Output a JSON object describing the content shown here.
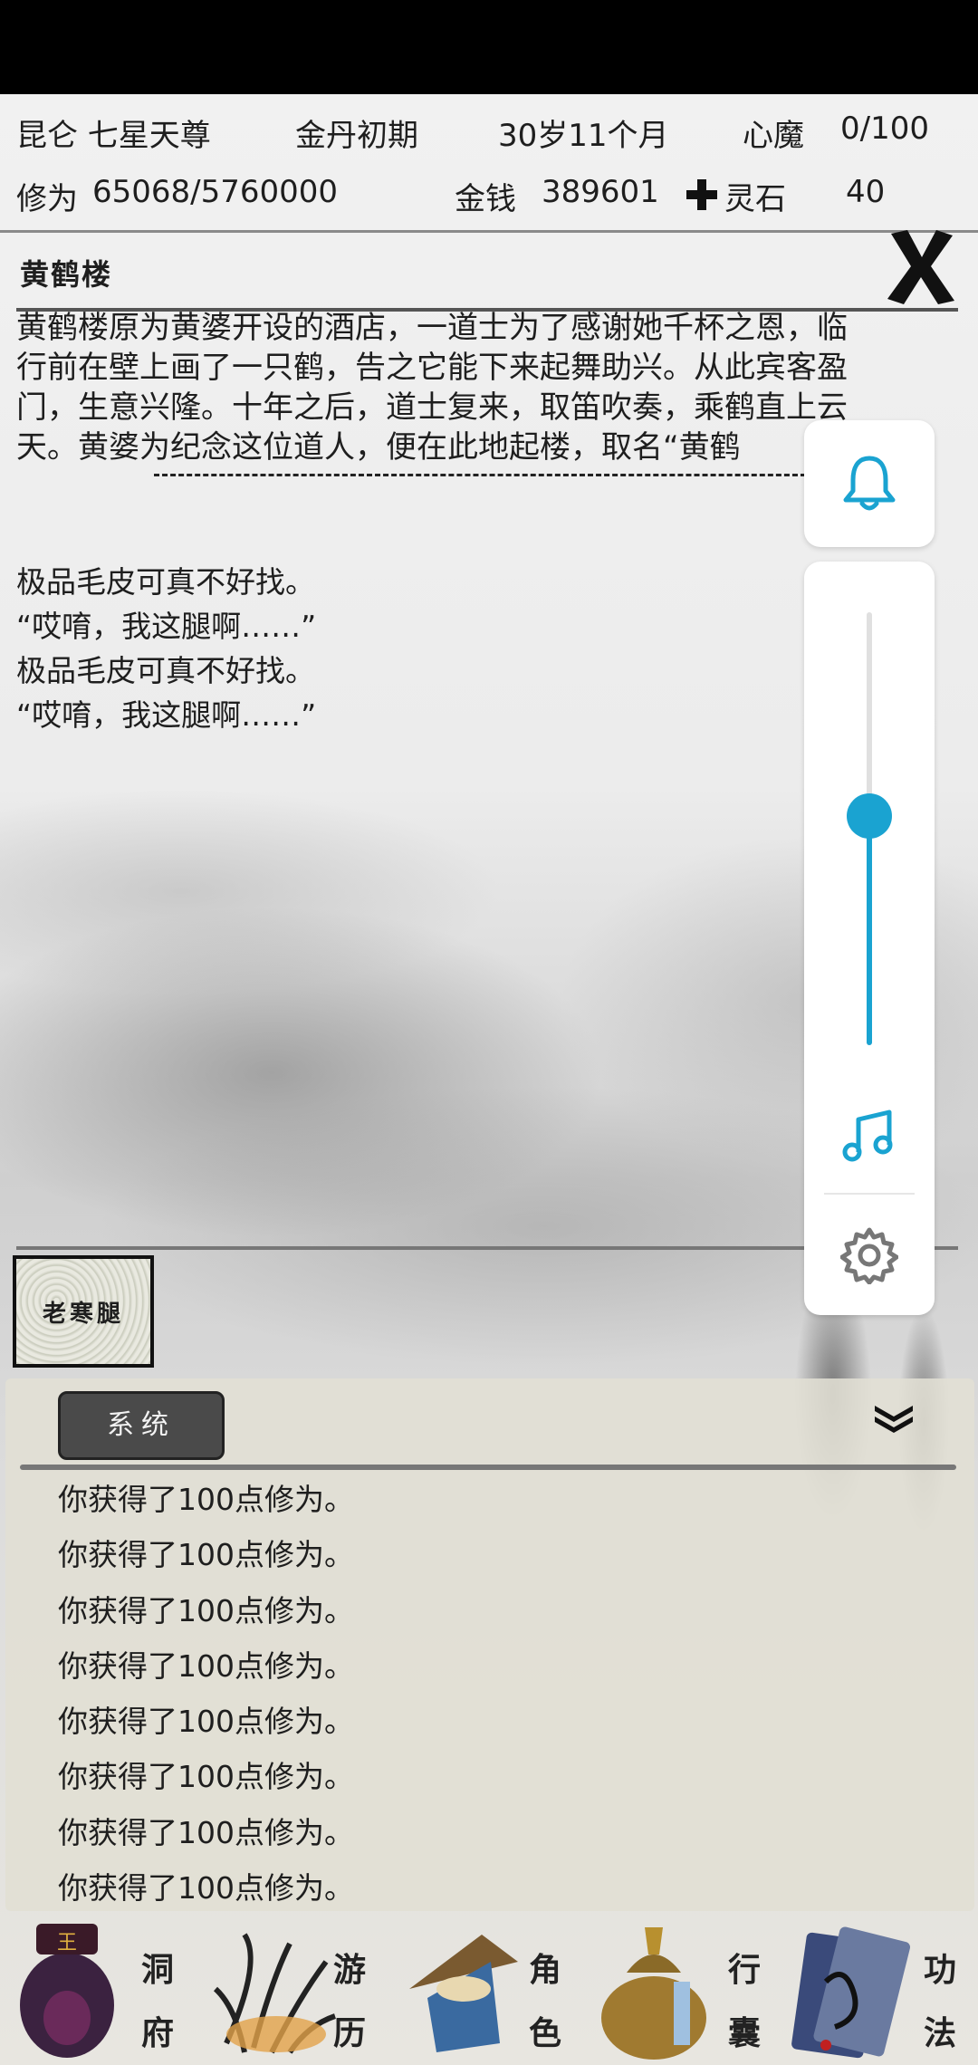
{
  "stats": {
    "sect_title": "昆仑 七星天尊",
    "realm": "金丹初期",
    "age": "30岁11个月",
    "demon_label": "心魔",
    "demon_value": "0/100",
    "cultivation_label": "修为",
    "cultivation_value": "65068/5760000",
    "money_label": "金钱",
    "money_value": "389601",
    "spirit_stone_label": "灵石",
    "spirit_stone_value": "40"
  },
  "location": {
    "title": "黄鹤楼",
    "description_lines": [
      "黄鹤楼原为黄婆开设的酒店，一道士为了感谢她千杯之恩，临",
      "行前在壁上画了一只鹤，告之它能下来起舞助兴。从此宾客盈",
      "门，生意兴隆。十年之后，道士复来，取笛吹奏，乘鹤直上云",
      "天。黄婆为纪念这位道人，便在此地起楼，取名“黄鹤"
    ],
    "event_lines": [
      "极品毛皮可真不好找。",
      "“哎唷，我这腿啊……”",
      "极品毛皮可真不好找。",
      "“哎唷，我这腿啊……”"
    ]
  },
  "npc": {
    "label": "老寒腿"
  },
  "log": {
    "tab_label": "系统",
    "entries": [
      "你获得了100点修为。",
      "你获得了100点修为。",
      "你获得了100点修为。",
      "你获得了100点修为。",
      "你获得了100点修为。",
      "你获得了100点修为。",
      "你获得了100点修为。",
      "你获得了100点修为。"
    ]
  },
  "nav": [
    {
      "id": "cave",
      "chars": [
        "洞",
        "府"
      ],
      "icon": "cave-lantern-icon"
    },
    {
      "id": "travel",
      "chars": [
        "游",
        "历"
      ],
      "icon": "grass-icon"
    },
    {
      "id": "character",
      "chars": [
        "角",
        "色"
      ],
      "icon": "straw-hat-icon"
    },
    {
      "id": "bag",
      "chars": [
        "行",
        "囊"
      ],
      "icon": "sack-icon"
    },
    {
      "id": "skills",
      "chars": [
        "功",
        "法"
      ],
      "icon": "scroll-book-icon"
    }
  ],
  "volume_panel": {
    "level": 0.53,
    "accent": "#1aa3d1",
    "icons": [
      "bell-icon",
      "music-note-icon",
      "gear-icon"
    ]
  }
}
